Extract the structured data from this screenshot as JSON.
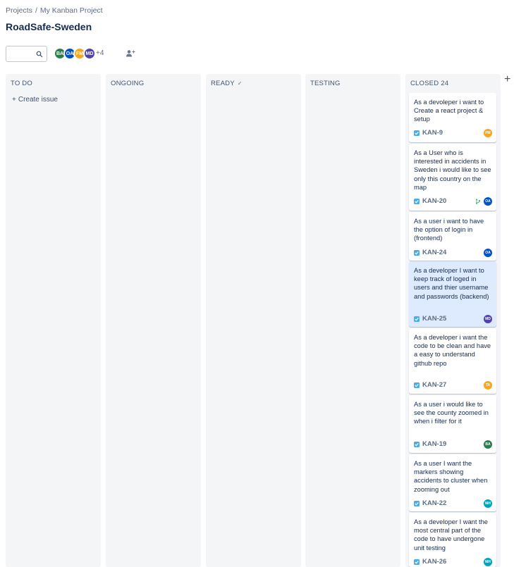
{
  "breadcrumb": {
    "projects": "Projects",
    "separator": "/",
    "project": "My Kanban Project"
  },
  "page_title": "RoadSafe-Sweden",
  "search": {
    "value": "",
    "placeholder": ""
  },
  "avatars": [
    {
      "initials": "BA",
      "color": "#2e7d4f"
    },
    {
      "initials": "OA",
      "color": "#0052cc"
    },
    {
      "initials": "FM",
      "color": "#f5a623"
    },
    {
      "initials": "MD",
      "color": "#5243aa"
    }
  ],
  "avatars_more": "+4",
  "add_column_label": "+",
  "columns": {
    "todo": {
      "title": "TO DO",
      "create_issue": "Create issue"
    },
    "ongoing": {
      "title": "ONGOING"
    },
    "ready": {
      "title": "READY"
    },
    "testing": {
      "title": "TESTING"
    },
    "closed": {
      "title": "CLOSED",
      "count": "24"
    }
  },
  "cards": [
    {
      "summary": "As a devoleper i want to Create a react project & setup",
      "key": "KAN-9",
      "assignee": "FM",
      "assignee_color": "#f5a623"
    },
    {
      "summary": "As a User who is interested in accidents in Sweden i would like to see only this country on the map",
      "key": "KAN-20",
      "assignee": "OA",
      "assignee_color": "#0052cc"
    },
    {
      "summary": "As a user i want to have the option of login in (frontend)",
      "key": "KAN-24",
      "assignee": "OA",
      "assignee_color": "#0052cc"
    },
    {
      "summary": "As a developer I want to keep track of loged in users and thier username and passwords (backend)",
      "key": "KAN-25",
      "assignee": "MD",
      "assignee_color": "#5243aa"
    },
    {
      "summary": "As a developer i want the code to be clean and have a easy to understand github repo",
      "key": "KAN-27",
      "assignee": "TA",
      "assignee_color": "#f5a623"
    },
    {
      "summary": "As a user i would like to see the county zoomed in when i filter for it",
      "key": "KAN-19",
      "assignee": "BA",
      "assignee_color": "#2e7d4f"
    },
    {
      "summary": "As a user I want the markers showing accidents to cluster when zooming out",
      "key": "KAN-22",
      "assignee": "MH",
      "assignee_color": "#00a3bf"
    },
    {
      "summary": "As a developer I want the most central part of the code to have undergone unit testing",
      "key": "KAN-26",
      "assignee": "MH",
      "assignee_color": "#00a3bf"
    }
  ],
  "colors": {
    "story_icon": "#4bade8",
    "column_bg": "#f4f5f7",
    "highlight": "#deebff"
  }
}
